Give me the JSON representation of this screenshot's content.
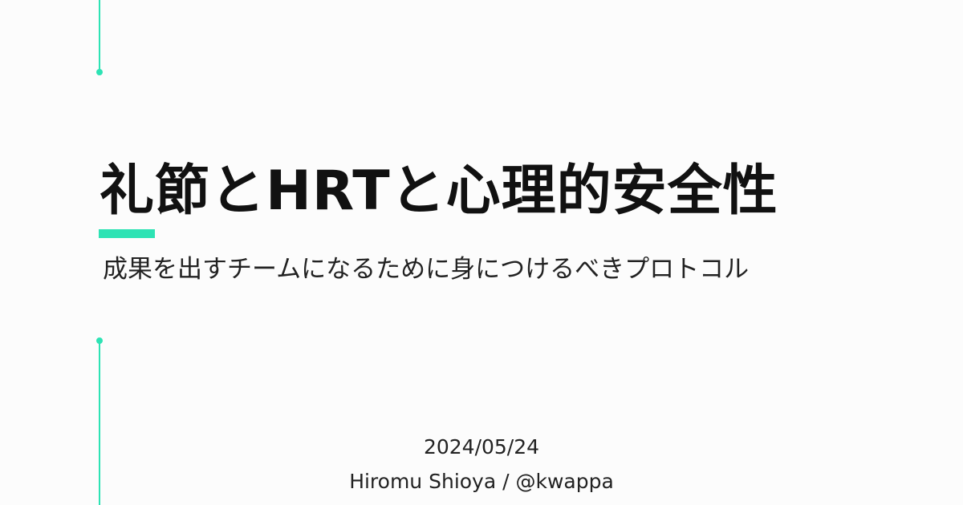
{
  "slide": {
    "title": "礼節とHRTと心理的安全性",
    "subtitle": "成果を出すチームになるために身につけるべきプロトコル",
    "date": "2024/05/24",
    "author": "Hiromu Shioya / @kwappa"
  },
  "colors": {
    "accent": "#2de3b4",
    "background": "#fcfcfc",
    "text": "#111111"
  }
}
